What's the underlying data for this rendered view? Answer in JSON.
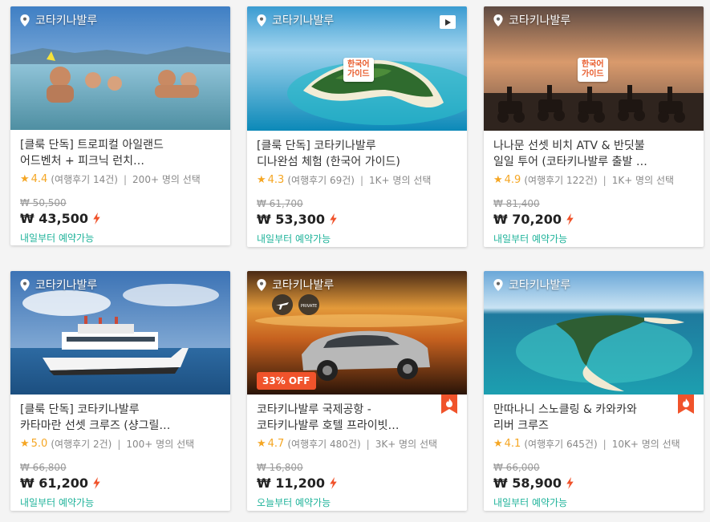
{
  "colors": {
    "accent": "#f0532b",
    "star": "#f5a623",
    "available": "#1fb39a",
    "price": "#222222"
  },
  "cards": [
    {
      "location": "코타키나발루",
      "title": "[클룩 단독] 트로피컬 아일랜드\n어드벤처 + 피크닉 런치…",
      "rating": "4.4",
      "reviews": "(여행후기 14건)",
      "booked": "200+ 명의 선택",
      "original_price": "₩ 50,500",
      "price": "₩ 43,500",
      "availability": "내일부터 예약가능",
      "image": "beach-family"
    },
    {
      "location": "코타키나발루",
      "title": "[클룩 단독] 코타키나발루\n디나완섬 체험 (한국어 가이드)",
      "rating": "4.3",
      "reviews": "(여행후기 69건)",
      "booked": "1K+ 명의 선택",
      "original_price": "₩ 61,700",
      "price": "₩ 53,300",
      "availability": "내일부터 예약가능",
      "badge": "한국어\n가이드",
      "has_video": true,
      "image": "island-aerial"
    },
    {
      "location": "코타키나발루",
      "title": "나나문 선셋 비치 ATV & 반딧불\n일일 투어 (코타키나발루 출발 …",
      "rating": "4.9",
      "reviews": "(여행후기 122건)",
      "booked": "1K+ 명의 선택",
      "original_price": "₩ 81,400",
      "price": "₩ 70,200",
      "availability": "내일부터 예약가능",
      "badge": "한국어\n가이드",
      "image": "atv-sunset"
    },
    {
      "location": "코타키나발루",
      "title": "[클룩 단독] 코타키나발루\n카타마란 선셋 크루즈 (샹그릴…",
      "rating": "5.0",
      "reviews": "(여행후기 2건)",
      "booked": "100+ 명의 선택",
      "original_price": "₩ 66,800",
      "price": "₩ 61,200",
      "availability": "내일부터 예약가능",
      "image": "catamaran"
    },
    {
      "location": "코타키나발루",
      "title": "코타키나발루 국제공항 -\n코타키나발루 호텔 프라이빗…",
      "rating": "4.7",
      "reviews": "(여행후기 480건)",
      "booked": "3K+ 명의 선택",
      "original_price": "₩ 16,800",
      "price": "₩ 11,200",
      "availability": "오늘부터 예약가능",
      "discount": "33% OFF",
      "private_label": "PRIVATE",
      "hot": true,
      "image": "car-sunset"
    },
    {
      "location": "코타키나발루",
      "title": "만따나니 스노클링 & 카와카와\n리버 크루즈",
      "rating": "4.1",
      "reviews": "(여행후기 645건)",
      "booked": "10K+ 명의 선택",
      "original_price": "₩ 66,000",
      "price": "₩ 58,900",
      "availability": "내일부터 예약가능",
      "hot": true,
      "image": "sandbar"
    }
  ]
}
